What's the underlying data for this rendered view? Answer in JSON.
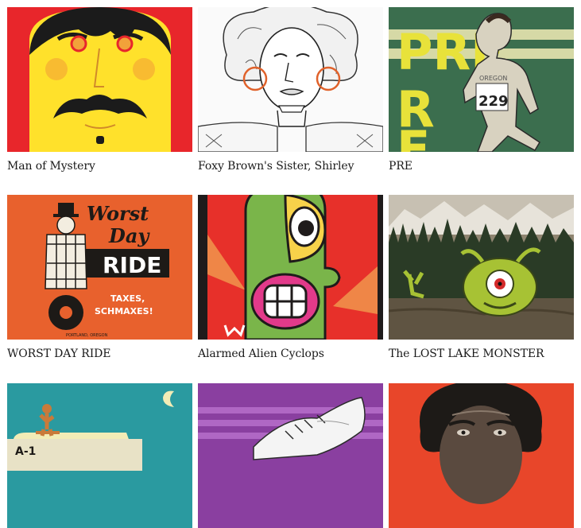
{
  "gallery": {
    "items": [
      {
        "title": "Man of Mystery",
        "illustration": "mustached-yellow-face"
      },
      {
        "title": "Foxy Brown's Sister, Shirley",
        "illustration": "afro-woman-sketch"
      },
      {
        "title": "PRE",
        "illustration": "runner-poster"
      },
      {
        "title": "WORST DAY RIDE",
        "illustration": "barrel-unicycle-poster"
      },
      {
        "title": "Alarmed Alien Cyclops",
        "illustration": "green-cyclops-alien"
      },
      {
        "title": "The LOST LAKE MONSTER",
        "illustration": "lake-monster"
      },
      {
        "title": "",
        "illustration": "van-night-scene"
      },
      {
        "title": "",
        "illustration": "sneaker-drawing"
      },
      {
        "title": "",
        "illustration": "portrait-afro-man"
      }
    ],
    "poster_text": {
      "pre_letters": "PRE",
      "bib_number": "229",
      "shirt": "OREGON",
      "worst": "Worst",
      "day": "Day",
      "ride": "RIDE",
      "taxes": "TAXES,",
      "schmaxes": "SCHMAXES!",
      "location": "PORTLAND, OREGON",
      "van_sign": "A-1"
    }
  }
}
